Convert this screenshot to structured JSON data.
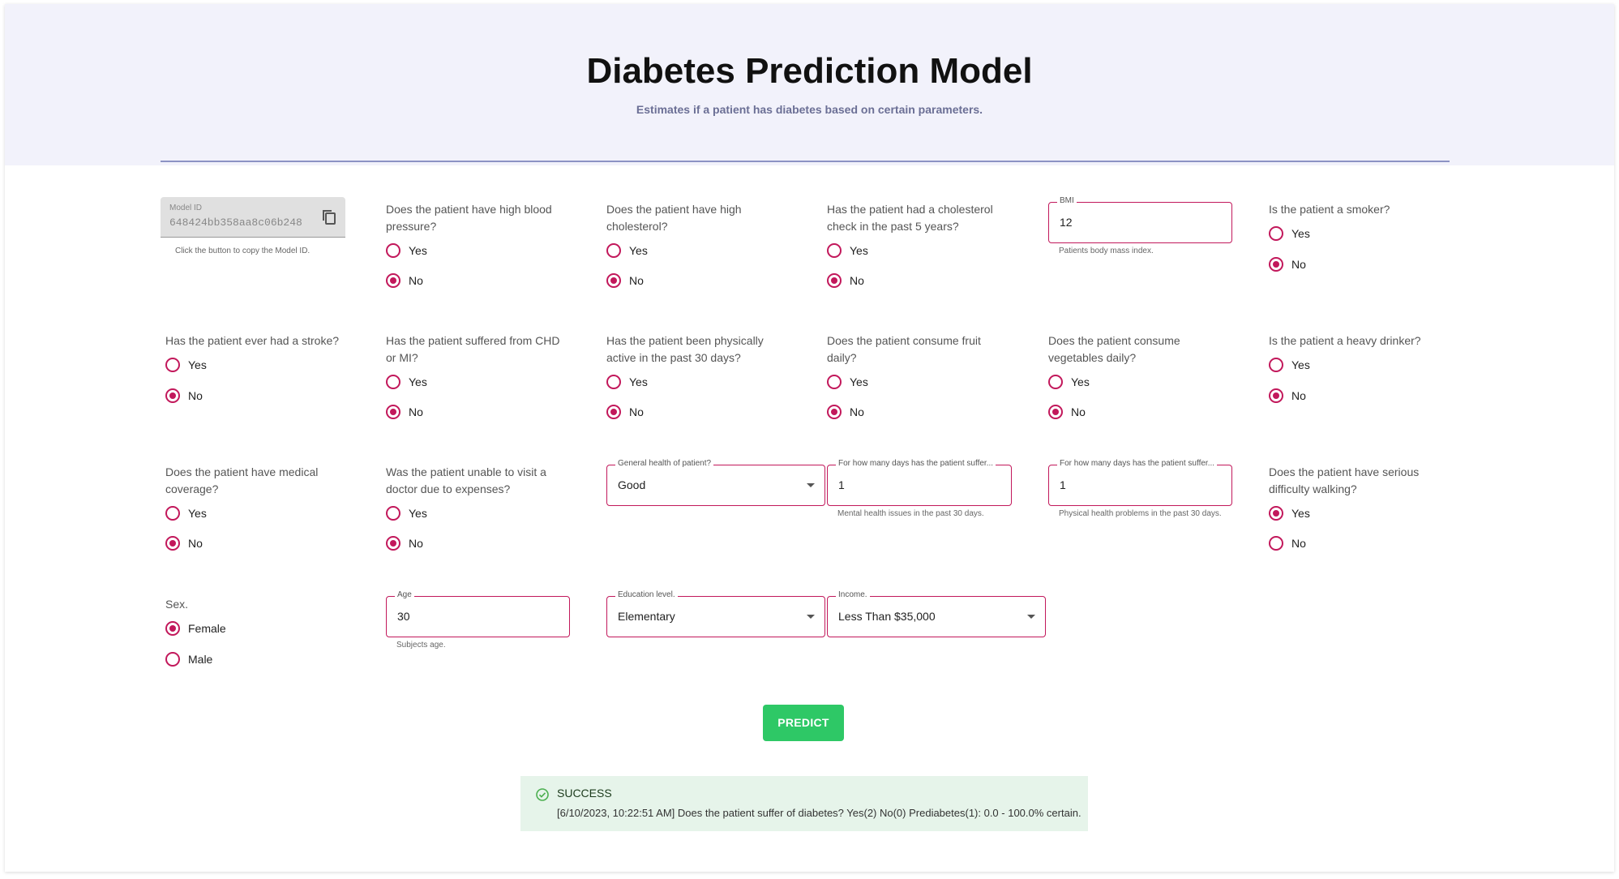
{
  "header": {
    "title": "Diabetes Prediction Model",
    "subtitle": "Estimates if a patient has diabetes based on certain parameters."
  },
  "model_id": {
    "label": "Model ID",
    "value": "648424bb358aa8c06b248",
    "helper": "Click the button to copy the Model ID."
  },
  "radio_options": {
    "yes": "Yes",
    "no": "No",
    "female": "Female",
    "male": "Male"
  },
  "questions": {
    "high_bp": {
      "label": "Does the patient have high blood pressure?",
      "selected": "No"
    },
    "high_chol": {
      "label": "Does the patient have high cholesterol?",
      "selected": "No"
    },
    "chol_check": {
      "label": "Has the patient had a cholesterol check in the past 5 years?",
      "selected": "No"
    },
    "smoker": {
      "label": "Is the patient a smoker?",
      "selected": "No"
    },
    "stroke": {
      "label": "Has the patient ever had a stroke?",
      "selected": "No"
    },
    "chd": {
      "label": "Has the patient suffered from CHD or MI?",
      "selected": "No"
    },
    "phys_active": {
      "label": "Has the patient been physically active in the past 30 days?",
      "selected": "No"
    },
    "fruit": {
      "label": "Does the patient consume fruit daily?",
      "selected": "No"
    },
    "veggies": {
      "label": "Does the patient consume vegetables daily?",
      "selected": "No"
    },
    "drinker": {
      "label": "Is the patient a heavy drinker?",
      "selected": "No"
    },
    "coverage": {
      "label": "Does the patient have medical coverage?",
      "selected": "No"
    },
    "doctor_cost": {
      "label": "Was the patient unable to visit a doctor due to expenses?",
      "selected": "No"
    },
    "walking": {
      "label": "Does the patient have serious difficulty walking?",
      "selected": "Yes"
    },
    "sex": {
      "label": "Sex.",
      "selected": "Female"
    }
  },
  "inputs": {
    "bmi": {
      "label": "BMI",
      "value": "12",
      "helper": "Patients body mass index."
    },
    "general_health": {
      "label": "General health of patient?",
      "value": "Good"
    },
    "mental_days": {
      "label": "For how many days has the patient suffer...",
      "value": "1",
      "helper": "Mental health issues in the past 30 days."
    },
    "physical_days": {
      "label": "For how many days has the patient suffer...",
      "value": "1",
      "helper": "Physical health problems in the past 30 days."
    },
    "age": {
      "label": "Age",
      "value": "30",
      "helper": "Subjects age."
    },
    "education": {
      "label": "Education level.",
      "value": "Elementary"
    },
    "income": {
      "label": "Income.",
      "value": "Less Than $35,000"
    }
  },
  "predict_label": "PREDICT",
  "result": {
    "status": "SUCCESS",
    "message": "[6/10/2023, 10:22:51 AM] Does the patient suffer of diabetes? Yes(2) No(0) Prediabetes(1): 0.0 - 100.0% certain."
  },
  "colors": {
    "accent": "#c2185b",
    "header_bg": "#f2f2fb",
    "predict": "#2ec866",
    "success_bg": "#e6f4ea"
  }
}
